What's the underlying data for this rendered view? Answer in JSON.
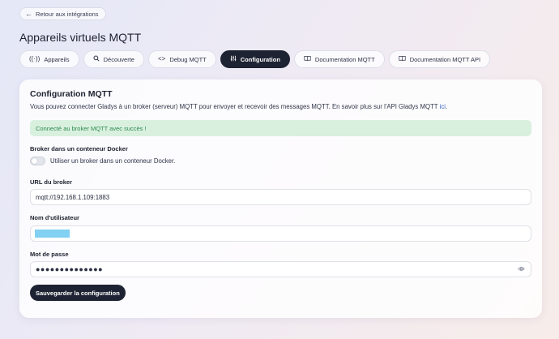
{
  "header": {
    "back_label": "Retour aux intégrations",
    "title": "Appareils virtuels MQTT"
  },
  "tabs": [
    {
      "label": "Appareils",
      "icon": "broadcast-icon",
      "active": false
    },
    {
      "label": "Découverte",
      "icon": "search-icon",
      "active": false
    },
    {
      "label": "Debug MQTT",
      "icon": "code-icon",
      "active": false
    },
    {
      "label": "Configuration",
      "icon": "sliders-icon",
      "active": true
    },
    {
      "label": "Documentation MQTT",
      "icon": "book-icon",
      "active": false
    },
    {
      "label": "Documentation MQTT API",
      "icon": "book-icon",
      "active": false
    }
  ],
  "card": {
    "title": "Configuration MQTT",
    "intro": "Vous pouvez connecter Gladys à un broker (serveur) MQTT pour envoyer et recevoir des messages MQTT. En savoir plus sur l'API Gladys MQTT ",
    "intro_link": "ici",
    "intro_end": ".",
    "alert": "Connecté au broker MQTT avec succès !",
    "docker_label": "Broker dans un conteneur Docker",
    "docker_switch_label": "Utiliser un broker dans un conteneur Docker.",
    "docker_enabled": false,
    "url_label": "URL du broker",
    "url_value": "mqtt://192.168.1.109:1883",
    "user_label": "Nom d'utilisateur",
    "password_label": "Mot de passe",
    "password_value": "●●●●●●●●●●●●●●",
    "save_label": "Sauvegarder la configuration"
  },
  "colors": {
    "primary": "#1e2333",
    "success_bg": "#d9f0df",
    "success_text": "#2c8a4e",
    "link": "#3b64c8"
  }
}
